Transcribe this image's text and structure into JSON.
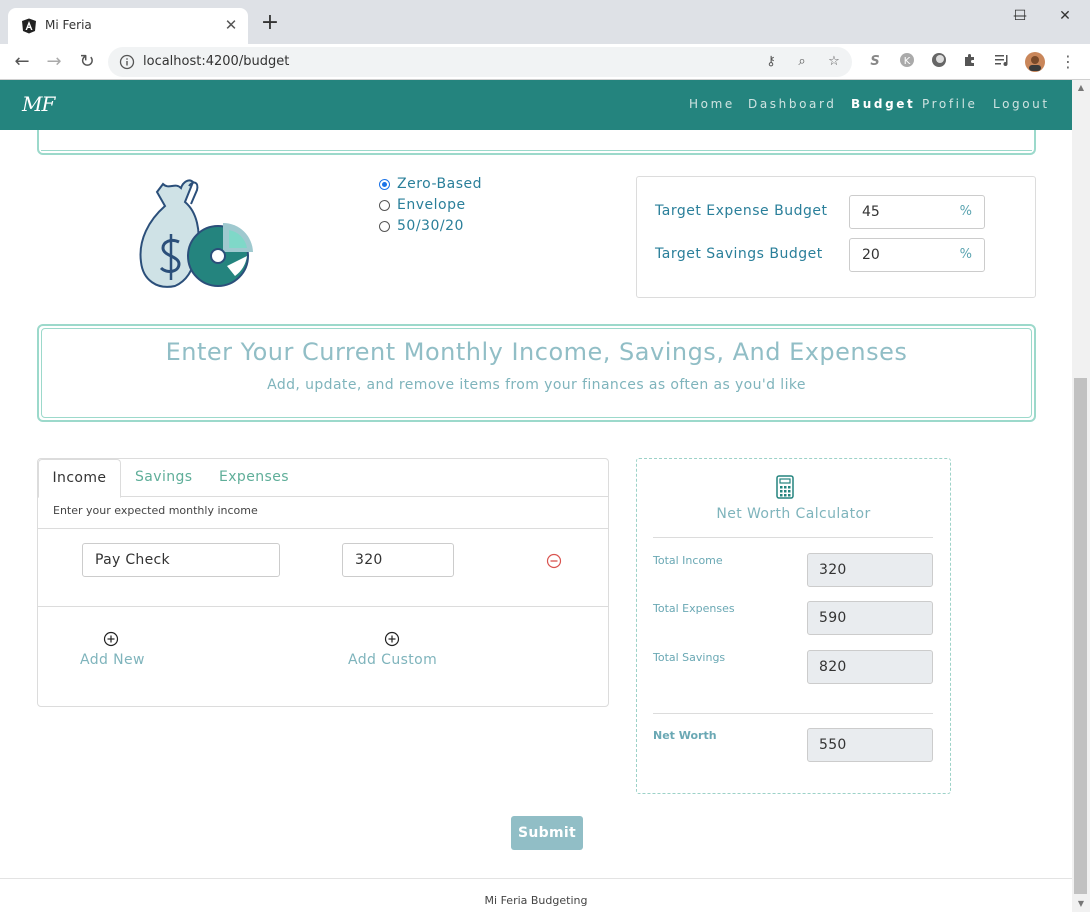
{
  "browser": {
    "tab_title": "Mi Feria",
    "url": "localhost:4200/budget",
    "new_tab_symbol": "+",
    "window_controls": {
      "minimize": "—",
      "maximize": "☐",
      "close": "✕"
    }
  },
  "navbar": {
    "brand": "MF",
    "links": [
      {
        "label": "Home",
        "active": false
      },
      {
        "label": "Dashboard",
        "active": false
      },
      {
        "label": "Budget",
        "active": true
      },
      {
        "label": "Profile",
        "active": false
      },
      {
        "label": "Logout",
        "active": false
      }
    ]
  },
  "budget_method": {
    "options": [
      "Zero-Based",
      "Envelope",
      "50/30/20"
    ],
    "selected": "Zero-Based"
  },
  "targets": {
    "expense": {
      "label": "Target Expense Budget",
      "value": "45",
      "unit": "%"
    },
    "savings": {
      "label": "Target Savings Budget",
      "value": "20",
      "unit": "%"
    }
  },
  "banner": {
    "title": "Enter Your Current Monthly Income, Savings, And Expenses",
    "subtitle": "Add, update, and remove items from your finances as often as you'd like"
  },
  "finance_tabs": {
    "tabs": [
      "Income",
      "Savings",
      "Expenses"
    ],
    "active_tab": "Income",
    "description": "Enter your expected monthly income",
    "rows": [
      {
        "name": "Pay Check",
        "amount": "320"
      }
    ],
    "add_new_label": "Add New",
    "add_custom_label": "Add Custom"
  },
  "calculator": {
    "title": "Net Worth Calculator",
    "total_income_label": "Total Income",
    "total_income": "320",
    "total_expenses_label": "Total Expenses",
    "total_expenses": "590",
    "total_savings_label": "Total Savings",
    "total_savings": "820",
    "net_worth_label": "Net Worth",
    "net_worth": "550"
  },
  "submit_label": "Submit",
  "footer": "Mi Feria Budgeting",
  "colors": {
    "navbar": "#24847e",
    "accent_teal": "#9cd9cb",
    "muted_blue": "#91bec6",
    "link_blue": "#2a7f9a",
    "remove_red": "#d9534f"
  }
}
